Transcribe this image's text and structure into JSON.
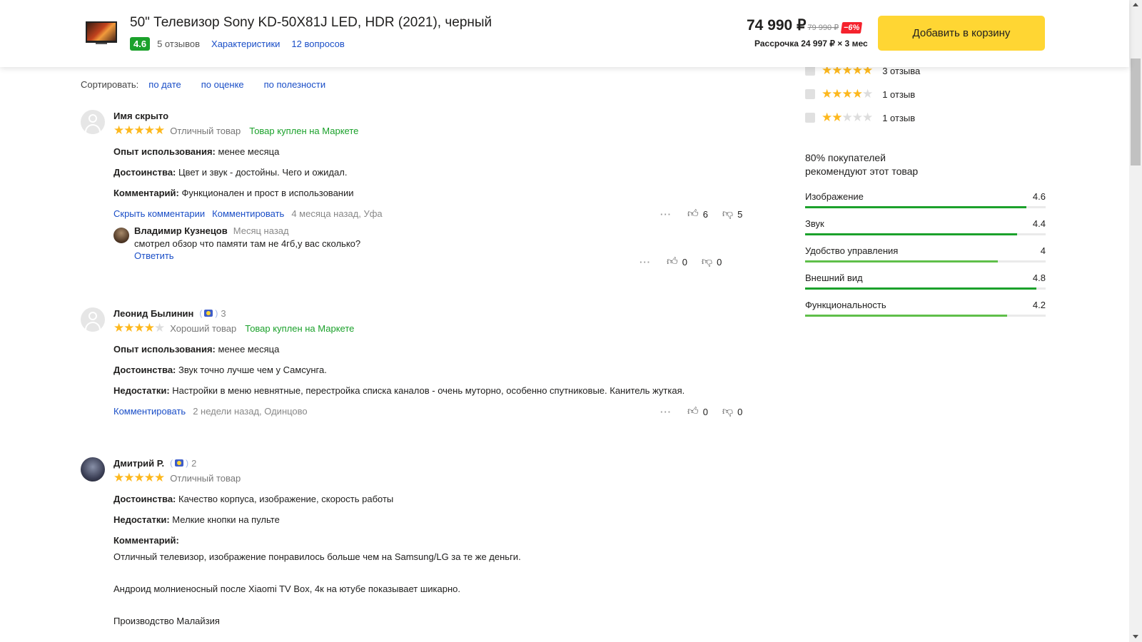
{
  "header": {
    "title": "50\" Телевизор Sony KD-50X81J LED, HDR (2021), черный",
    "rating": "4.6",
    "reviews_link": "5 отзывов",
    "specs_link": "Характеристики",
    "questions_link": "12 вопросов",
    "price": "74 990 ₽",
    "old_price": "79 990 ₽",
    "discount": "−6%",
    "installment": "Рассрочка 24 997 ₽ × 3 мес",
    "cart_button": "Добавить в корзину"
  },
  "sort": {
    "label": "Сортировать:",
    "options": [
      "по дате",
      "по оценке",
      "по полезности"
    ]
  },
  "reviews": [
    {
      "author": "Имя скрыто",
      "stars": 5,
      "verdict": "Отличный товар",
      "bought": "Товар куплен на Маркете",
      "fields": [
        {
          "label": "Опыт использования:",
          "text": "менее месяца"
        },
        {
          "label": "Достоинства:",
          "text": "Цвет и звук - достойны. Чего и ожидал."
        },
        {
          "label": "Комментарий:",
          "text": "Функционален и прост в использовании"
        }
      ],
      "hide_comments": "Скрыть комментарии",
      "comment": "Комментировать",
      "meta": "4 месяца назад, Уфа",
      "likes": "6",
      "dislikes": "5",
      "reply": {
        "author": "Владимир Кузнецов",
        "time": "Месяц назад",
        "text": "смотрел обзор что памяти там не 4гб,у вас сколько?",
        "answer": "Ответить",
        "likes": "0",
        "dislikes": "0"
      }
    },
    {
      "author": "Леонид Былинин",
      "badge_level": "3",
      "stars": 4,
      "verdict": "Хороший товар",
      "bought": "Товар куплен на Маркете",
      "fields": [
        {
          "label": "Опыт использования:",
          "text": "менее месяца"
        },
        {
          "label": "Достоинства:",
          "text": "Звук точно лучше чем у Самсунга."
        },
        {
          "label": "Недостатки:",
          "text": "Настройки в меню невнятные, перестройка списка каналов - очень муторно, особенно спутниковые. Канитель жуткая."
        }
      ],
      "comment": "Комментировать",
      "meta": "2 недели назад, Одинцово",
      "likes": "0",
      "dislikes": "0"
    },
    {
      "author": "Дмитрий Р.",
      "badge_level": "2",
      "stars": 5,
      "verdict": "Отличный товар",
      "fields": [
        {
          "label": "Достоинства:",
          "text": "Качество корпуса, изображение, скорость работы"
        },
        {
          "label": "Недостатки:",
          "text": "Мелкие кнопки на пульте"
        },
        {
          "label": "Комментарий:",
          "text": ""
        }
      ],
      "comment_lines": [
        "Отличный телевизор, изображение понравилось больше чем на Samsung/LG за те же деньги.",
        "Андроид молниеносный после Xiaomi TV Box, 4к на ютубе показывает шикарно.",
        "Производство Малайзия"
      ]
    }
  ],
  "rating_filters": [
    {
      "stars": 5,
      "label": "3 отзыва"
    },
    {
      "stars": 4,
      "label": "1 отзыв"
    },
    {
      "stars": 2,
      "label": "1 отзыв"
    }
  ],
  "recommend": "80% покупателей рекомендуют этот товар",
  "aspects": [
    {
      "name": "Изображение",
      "value": "4.6",
      "level": 0.92
    },
    {
      "name": "Звук",
      "value": "4.4",
      "level": 0.88
    },
    {
      "name": "Удобство управления",
      "value": "4",
      "level": 0.8
    },
    {
      "name": "Внешний вид",
      "value": "4.8",
      "level": 0.96
    },
    {
      "name": "Функциональность",
      "value": "4.2",
      "level": 0.84
    }
  ],
  "colors": {
    "accent_yellow": "#ffd633",
    "link_blue": "#1a4ec7",
    "green": "#1ba12b",
    "star": "#fdb81e",
    "discount_red": "#f5222d"
  }
}
